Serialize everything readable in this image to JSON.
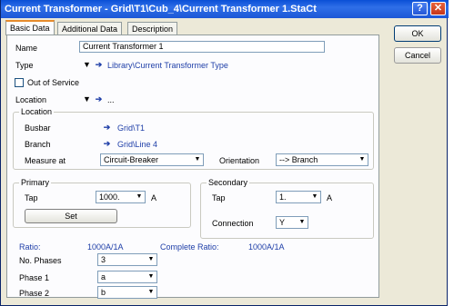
{
  "window": {
    "title": "Current Transformer - Grid\\T1\\Cub_4\\Current Transformer 1.StaCt",
    "help_glyph": "?",
    "close_glyph": "✕"
  },
  "tabs": [
    {
      "label": "Basic Data"
    },
    {
      "label": "Additional Data"
    },
    {
      "label": "Description"
    }
  ],
  "buttons": {
    "ok": "OK",
    "cancel": "Cancel",
    "set": "Set"
  },
  "form": {
    "name_label": "Name",
    "name_value": "Current Transformer 1",
    "type_label": "Type",
    "type_value": "Library\\Current Transformer Type",
    "out_of_service_label": "Out of Service",
    "location_label": "Location",
    "location_value": "...",
    "location_group_title": "Location",
    "busbar_label": "Busbar",
    "busbar_value": "Grid\\T1",
    "branch_label": "Branch",
    "branch_value": "Grid\\Line 4",
    "measure_at_label": "Measure at",
    "measure_at_value": "Circuit-Breaker",
    "orientation_label": "Orientation",
    "orientation_value": "--> Branch",
    "primary_title": "Primary",
    "primary_tap_label": "Tap",
    "primary_tap_value": "1000.",
    "primary_unit": "A",
    "secondary_title": "Secondary",
    "secondary_tap_label": "Tap",
    "secondary_tap_value": "1.",
    "secondary_unit": "A",
    "connection_label": "Connection",
    "connection_value": "Y",
    "ratio_label": "Ratio:",
    "ratio_value": "1000A/1A",
    "complete_ratio_label": "Complete Ratio:",
    "complete_ratio_value": "1000A/1A",
    "phases_label": "No. Phases",
    "phases_value": "3",
    "phase1_label": "Phase 1",
    "phase1_value": "a",
    "phase2_label": "Phase 2",
    "phase2_value": "b"
  },
  "icons": {
    "dropdown": "▼",
    "arrow": "➔"
  },
  "colors": {
    "title_bar": "#1c57d6",
    "link": "#1f3fa8",
    "active_tab_accent": "#e68b2c"
  }
}
